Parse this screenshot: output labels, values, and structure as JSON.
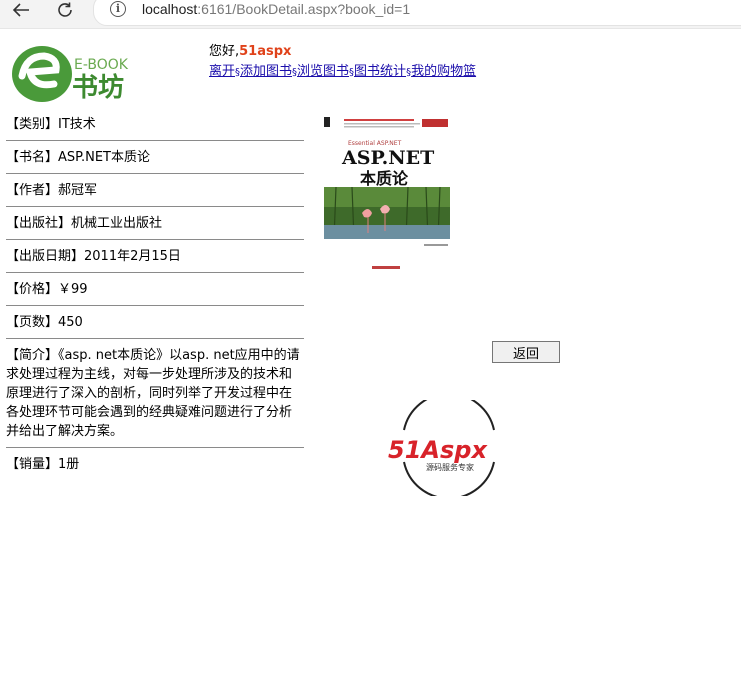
{
  "browser": {
    "url_host": "localhost",
    "url_path": ":6161/BookDetail.aspx?book_id=1"
  },
  "header": {
    "logo_text_en": "E-BOOK",
    "logo_text_cn": "书坊",
    "greeting": "您好,",
    "username": "51aspx",
    "links": [
      {
        "label": "离开"
      },
      {
        "label": "添加图书"
      },
      {
        "label": "浏览图书"
      },
      {
        "label": "图书统计"
      },
      {
        "label": "我的购物篮"
      }
    ],
    "separator": "§"
  },
  "book": {
    "category": "【类别】IT技术",
    "title": "【书名】ASP.NET本质论",
    "author": "【作者】郝冠军",
    "publisher": "【出版社】机械工业出版社",
    "pub_date": "【出版日期】2011年2月15日",
    "price": "【价格】￥99",
    "pages": "【页数】450",
    "intro": "【简介】《asp. net本质论》以asp. net应用中的请求处理过程为主线，对每一步处理所涉及的技术和原理进行了深入的剖析，同时列举了开发过程中在各处理环节可能会遇到的经典疑难问题进行了分析并给出了解决方案。",
    "sales": "【销量】1册"
  },
  "cover": {
    "series": "Essential ASP.NET",
    "title_line1": "ASP.NET",
    "title_line2": "本质论"
  },
  "back_button": "返回",
  "footer_logo": {
    "brand": "51Aspx",
    "tagline": "源码服务专家"
  },
  "colors": {
    "logo_green": "#4a9a3a",
    "username": "#e0421a",
    "link": "#1a0dab",
    "aspx_red": "#d8232a",
    "aspx_green": "#3aaa35"
  }
}
